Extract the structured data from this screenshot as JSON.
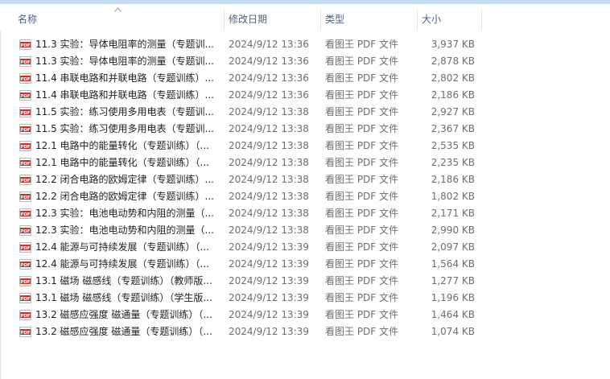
{
  "columns": {
    "name": "名称",
    "date": "修改日期",
    "type": "类型",
    "size": "大小"
  },
  "files": [
    {
      "name": "11.3 实验：导体电阻率的测量（专题训...",
      "date": "2024/9/12 13:36",
      "type": "看图王 PDF 文件",
      "size": "3,937 KB"
    },
    {
      "name": "11.3 实验：导体电阻率的测量（专题训...",
      "date": "2024/9/12 13:36",
      "type": "看图王 PDF 文件",
      "size": "2,878 KB"
    },
    {
      "name": "11.4 串联电路和并联电路（专题训练）...",
      "date": "2024/9/12 13:36",
      "type": "看图王 PDF 文件",
      "size": "2,802 KB"
    },
    {
      "name": "11.4 串联电路和并联电路（专题训练）...",
      "date": "2024/9/12 13:36",
      "type": "看图王 PDF 文件",
      "size": "2,186 KB"
    },
    {
      "name": "11.5 实验：练习使用多用电表（专题训...",
      "date": "2024/9/12 13:38",
      "type": "看图王 PDF 文件",
      "size": "2,927 KB"
    },
    {
      "name": "11.5 实验：练习使用多用电表（专题训...",
      "date": "2024/9/12 13:38",
      "type": "看图王 PDF 文件",
      "size": "2,367 KB"
    },
    {
      "name": "12.1 电路中的能量转化（专题训练）（...",
      "date": "2024/9/12 13:38",
      "type": "看图王 PDF 文件",
      "size": "2,535 KB"
    },
    {
      "name": "12.1 电路中的能量转化（专题训练）（...",
      "date": "2024/9/12 13:38",
      "type": "看图王 PDF 文件",
      "size": "2,235 KB"
    },
    {
      "name": "12.2 闭合电路的欧姆定律（专题训练）...",
      "date": "2024/9/12 13:38",
      "type": "看图王 PDF 文件",
      "size": "2,186 KB"
    },
    {
      "name": "12.2 闭合电路的欧姆定律（专题训练）...",
      "date": "2024/9/12 13:38",
      "type": "看图王 PDF 文件",
      "size": "1,802 KB"
    },
    {
      "name": "12.3 实验：电池电动势和内阻的测量（...",
      "date": "2024/9/12 13:38",
      "type": "看图王 PDF 文件",
      "size": "2,171 KB"
    },
    {
      "name": "12.3 实验：电池电动势和内阻的测量（...",
      "date": "2024/9/12 13:38",
      "type": "看图王 PDF 文件",
      "size": "2,990 KB"
    },
    {
      "name": "12.4 能源与可持续发展（专题训练）（...",
      "date": "2024/9/12 13:39",
      "type": "看图王 PDF 文件",
      "size": "2,097 KB"
    },
    {
      "name": "12.4 能源与可持续发展（专题训练）（...",
      "date": "2024/9/12 13:39",
      "type": "看图王 PDF 文件",
      "size": "1,564 KB"
    },
    {
      "name": "13.1 磁场 磁感线（专题训练）（教师版...",
      "date": "2024/9/12 13:39",
      "type": "看图王 PDF 文件",
      "size": "1,277 KB"
    },
    {
      "name": "13.1 磁场 磁感线（专题训练）（学生版...",
      "date": "2024/9/12 13:39",
      "type": "看图王 PDF 文件",
      "size": "1,196 KB"
    },
    {
      "name": "13.2 磁感应强度 磁通量（专题训练）（...",
      "date": "2024/9/12 13:39",
      "type": "看图王 PDF 文件",
      "size": "1,464 KB"
    },
    {
      "name": "13.2 磁感应强度 磁通量（专题训练）（...",
      "date": "2024/9/12 13:39",
      "type": "看图王 PDF 文件",
      "size": "1,074 KB"
    }
  ],
  "icon": {
    "file": "pdf-icon",
    "sort": "sort-ascending-icon"
  },
  "colors": {
    "header_text": "#4c607a",
    "pdf_red": "#d92b2b",
    "meta_text": "#6d6d6d"
  }
}
